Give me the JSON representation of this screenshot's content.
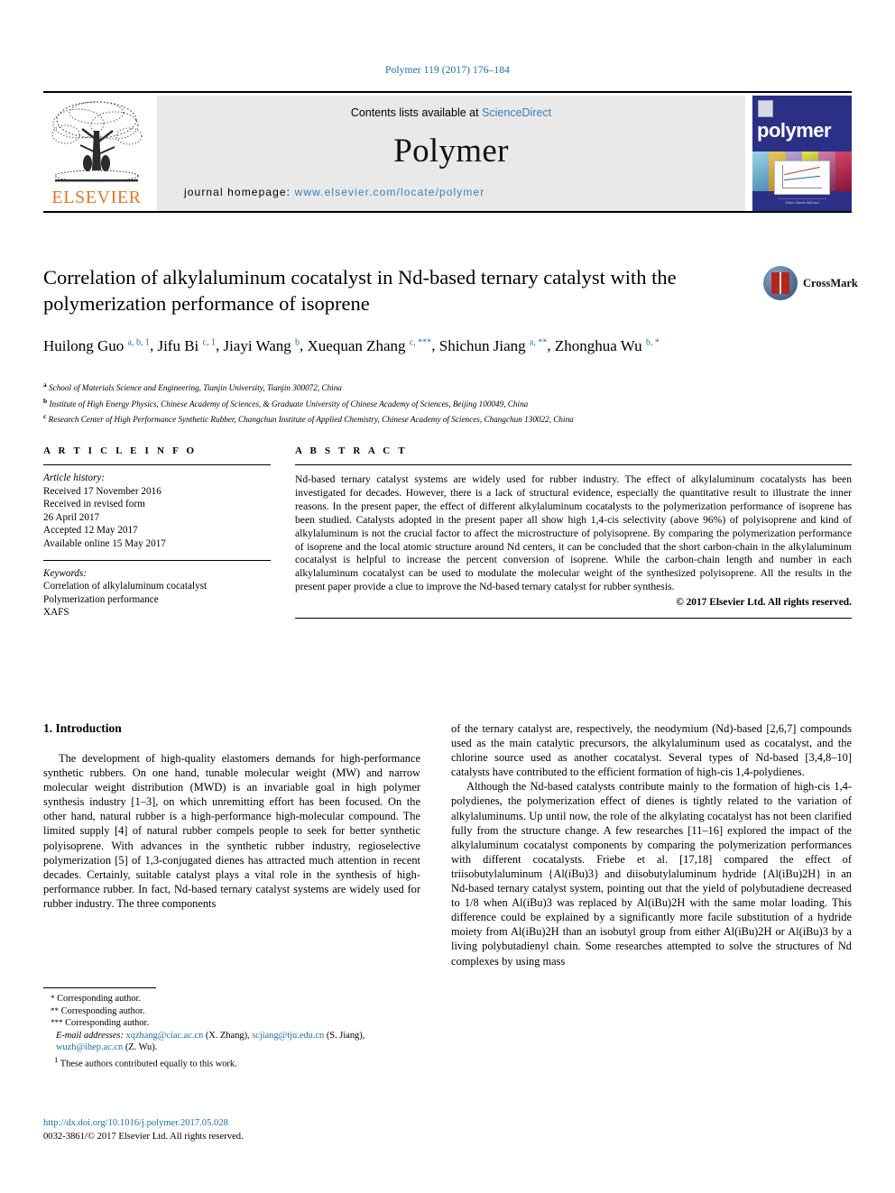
{
  "running_head": "Polymer 119 (2017) 176–184",
  "masthead": {
    "contents_prefix": "Contents lists available at ",
    "contents_link": "ScienceDirect",
    "journal_name": "Polymer",
    "homepage_label": "journal homepage: ",
    "homepage_url": "www.elsevier.com/locate/polymer",
    "publisher": "ELSEVIER",
    "cover": {
      "title": "polymer",
      "footer_line1": "———————————————",
      "footer_line2": "Editor: Sahsel Willi and"
    }
  },
  "article": {
    "title": "Correlation of alkylaluminum cocatalyst in Nd-based ternary catalyst with the polymerization performance of isoprene",
    "crossmark_label": "CrossMark",
    "authors": [
      {
        "name": "Huilong Guo",
        "marks": "a, b, 1"
      },
      {
        "name": "Jifu Bi",
        "marks": "c, 1"
      },
      {
        "name": "Jiayi Wang",
        "marks": "b"
      },
      {
        "name": "Xuequan Zhang",
        "marks": "c, ***"
      },
      {
        "name": "Shichun Jiang",
        "marks": "a, **"
      },
      {
        "name": "Zhonghua Wu",
        "marks": "b, *"
      }
    ],
    "affiliations": [
      {
        "mark": "a",
        "text": "School of Materials Science and Engineering, Tianjin University, Tianjin 300072, China"
      },
      {
        "mark": "b",
        "text": "Institute of High Energy Physics, Chinese Academy of Sciences, & Graduate University of Chinese Academy of Sciences, Beijing 100049, China"
      },
      {
        "mark": "c",
        "text": "Research Center of High Performance Synthetic Rubber, Changchun Institute of Applied Chemistry, Chinese Academy of Sciences, Changchun 130022, China"
      }
    ]
  },
  "article_info": {
    "heading": "A R T I C L E  I N F O",
    "history_label": "Article history:",
    "history": [
      "Received 17 November 2016",
      "Received in revised form",
      "26 April 2017",
      "Accepted 12 May 2017",
      "Available online 15 May 2017"
    ],
    "keywords_label": "Keywords:",
    "keywords": [
      "Correlation of alkylaluminum cocatalyst",
      "Polymerization performance",
      "XAFS"
    ]
  },
  "abstract": {
    "heading": "A B S T R A C T",
    "text": "Nd-based ternary catalyst systems are widely used for rubber industry. The effect of alkylaluminum cocatalysts has been investigated for decades. However, there is a lack of structural evidence, especially the quantitative result to illustrate the inner reasons. In the present paper, the effect of different alkylaluminum cocatalysts to the polymerization performance of isoprene has been studied. Catalysts adopted in the present paper all show high 1,4-cis selectivity (above 96%) of polyisoprene and kind of alkylaluminum is not the crucial factor to affect the microstructure of polyisoprene. By comparing the polymerization performance of isoprene and the local atomic structure around Nd centers, it can be concluded that the short carbon-chain in the alkylaluminum cocatalyst is helpful to increase the percent conversion of isoprene. While the carbon-chain length and number in each alkylaluminum cocatalyst can be used to modulate the molecular weight of the synthesized polyisoprene. All the results in the present paper provide a clue to improve the Nd-based ternary catalyst for rubber synthesis.",
    "copyright": "© 2017 Elsevier Ltd. All rights reserved."
  },
  "body": {
    "section_number_title": "1. Introduction",
    "left_paragraphs": [
      "The development of high-quality elastomers demands for high-performance synthetic rubbers. On one hand, tunable molecular weight (MW) and narrow molecular weight distribution (MWD) is an invariable goal in high polymer synthesis industry [1–3], on which unremitting effort has been focused. On the other hand, natural rubber is a high-performance high-molecular compound. The limited supply [4] of natural rubber compels people to seek for better synthetic polyisoprene. With advances in the synthetic rubber industry, regioselective polymerization [5] of 1,3-conjugated dienes has attracted much attention in recent decades. Certainly, suitable catalyst plays a vital role in the synthesis of high-performance rubber. In fact, Nd-based ternary catalyst systems are widely used for rubber industry. The three components"
    ],
    "right_paragraphs": [
      "of the ternary catalyst are, respectively, the neodymium (Nd)-based [2,6,7] compounds used as the main catalytic precursors, the alkylaluminum used as cocatalyst, and the chlorine source used as another cocatalyst. Several types of Nd-based [3,4,8–10] catalysts have contributed to the efficient formation of high-cis 1,4-polydienes.",
      "Although the Nd-based catalysts contribute mainly to the formation of high-cis 1,4-polydienes, the polymerization effect of dienes is tightly related to the variation of alkylaluminums. Up until now, the role of the alkylating cocatalyst has not been clarified fully from the structure change. A few researches [11–16] explored the impact of the alkylaluminum cocatalyst components by comparing the polymerization performances with different cocatalysts. Friebe et al. [17,18] compared the effect of triisobutylaluminum {Al(iBu)3} and diisobutylaluminum hydride {Al(iBu)2H} in an Nd-based ternary catalyst system, pointing out that the yield of polybutadiene decreased to 1/8 when Al(iBu)3 was replaced by Al(iBu)2H with the same molar loading. This difference could be explained by a significantly more facile substitution of a hydride moiety from Al(iBu)2H than an isobutyl group from either Al(iBu)2H or Al(iBu)3 by a living polybutadienyl chain. Some researches attempted to solve the structures of Nd complexes by using mass"
    ]
  },
  "footnotes": {
    "corresponding": [
      {
        "mark": "*",
        "text": "Corresponding author."
      },
      {
        "mark": "**",
        "text": "Corresponding author."
      },
      {
        "mark": "***",
        "text": "Corresponding author."
      }
    ],
    "email_label": "E-mail addresses:",
    "emails": [
      {
        "address": "xqzhang@ciac.ac.cn",
        "owner": "(X. Zhang),"
      },
      {
        "address": "scjiang@tju.edu.cn",
        "owner": "(S. Jiang),"
      },
      {
        "address": "wuzh@ihep.ac.cn",
        "owner": "(Z. Wu)."
      }
    ],
    "equal_contribution": {
      "mark": "1",
      "text": "These authors contributed equally to this work."
    }
  },
  "footer": {
    "doi": "http://dx.doi.org/10.1016/j.polymer.2017.05.028",
    "issn_line": "0032-3861/© 2017 Elsevier Ltd. All rights reserved."
  },
  "colors": {
    "link_blue": "#1a6fa8",
    "elsevier_orange": "#E87722",
    "cover_blue": "#2b2f86"
  }
}
